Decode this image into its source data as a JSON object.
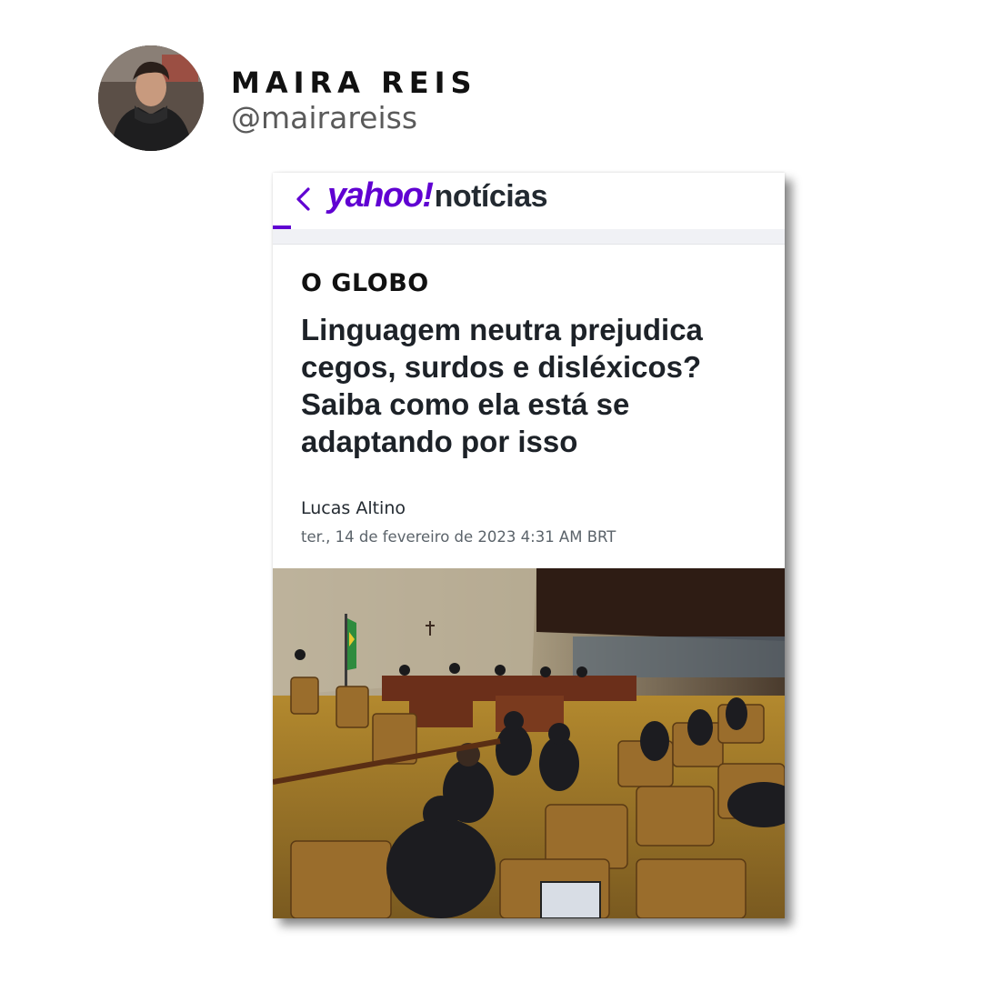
{
  "profile": {
    "name": "MAIRA REIS",
    "handle": "@mairareiss",
    "avatar_icon": "profile-photo"
  },
  "article_screenshot": {
    "nav": {
      "back_icon": "chevron-left-icon",
      "brand_yahoo": "yahoo!",
      "brand_section": "notícias",
      "accent_color": "#6001d2"
    },
    "source": "O GLOBO",
    "headline": "Linguagem neutra prejudica cegos, surdos e disléxicos? Saiba como ela está se adaptando por isso",
    "author": "Lucas Altino",
    "timestamp": "ter., 14 de fevereiro de 2023 4:31 AM BRT",
    "photo_icon": "courtroom-photo"
  }
}
